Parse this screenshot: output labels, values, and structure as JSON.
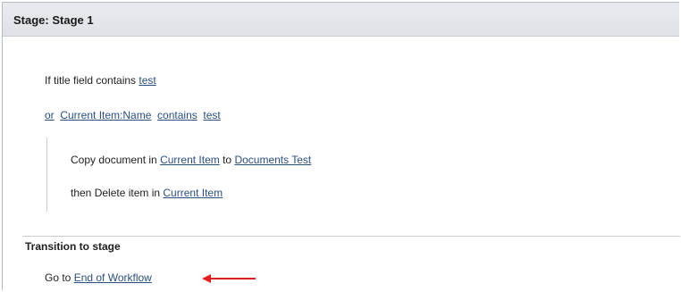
{
  "stage": {
    "title": "Stage: Stage 1"
  },
  "conditions": {
    "line1_prefix": "If title field contains ",
    "line1_value": "test",
    "line2_or": "or",
    "line2_field": "Current Item:Name",
    "line2_operator": "contains",
    "line2_value": "test"
  },
  "actions": {
    "copy_prefix": "Copy document in ",
    "copy_source": "Current Item",
    "copy_to": " to ",
    "copy_target": "Documents Test",
    "delete_prefix": "then Delete item in ",
    "delete_target": "Current Item"
  },
  "transition": {
    "title": "Transition to stage",
    "goto_prefix": "Go to ",
    "goto_target": "End of Workflow"
  },
  "colors": {
    "link": "#2a4f82",
    "arrow": "#e02020",
    "header_bg": "#e3e7eb"
  },
  "icons": {
    "annotation_arrow": "red-left-arrow-icon"
  }
}
